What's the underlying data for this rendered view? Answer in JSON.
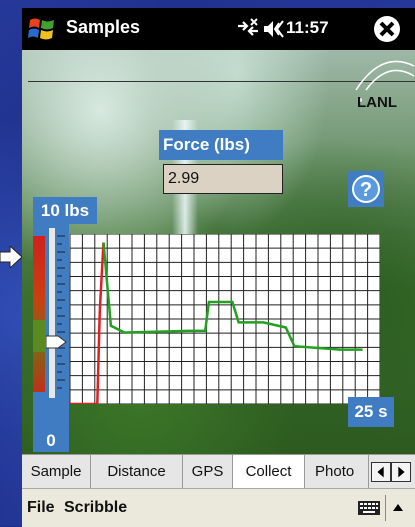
{
  "window": {
    "title": "Samples",
    "clock": "11:57"
  },
  "header": {
    "logo_text": "LANL"
  },
  "force": {
    "label": "Force (lbs)",
    "value": "2.99"
  },
  "scale": {
    "max_label": "10 lbs",
    "min_label": "0",
    "duration_label": "25 s"
  },
  "tabs": [
    {
      "label": "Sample",
      "active": false
    },
    {
      "label": "Distance",
      "active": false
    },
    {
      "label": "GPS",
      "active": false
    },
    {
      "label": "Collect",
      "active": true
    },
    {
      "label": "Photo",
      "active": false
    }
  ],
  "menu": {
    "file": "File",
    "scribble": "Scribble"
  },
  "colors": {
    "accent_blue": "#3f7cc2",
    "trace_green": "#22a020",
    "trace_red": "#e02020"
  },
  "chart_data": {
    "type": "line",
    "xlim": [
      0,
      25
    ],
    "ylim": [
      0,
      10
    ],
    "series": [
      {
        "color": "#e02020",
        "x": [
          0,
          2.2,
          2.4,
          2.7
        ],
        "y": [
          0,
          0,
          5.5,
          9.5
        ]
      },
      {
        "color": "#22a020",
        "x": [
          2.7,
          3.3,
          4.4,
          9.5,
          10.9,
          11.2,
          13.1,
          13.6,
          14.4,
          15.2,
          15.6,
          17.4,
          18.1,
          21.8,
          23.6
        ],
        "y": [
          9.5,
          4.6,
          4.2,
          4.3,
          4.3,
          6.0,
          6.0,
          4.8,
          4.8,
          4.8,
          4.8,
          4.5,
          3.4,
          3.2,
          3.2
        ]
      }
    ]
  }
}
